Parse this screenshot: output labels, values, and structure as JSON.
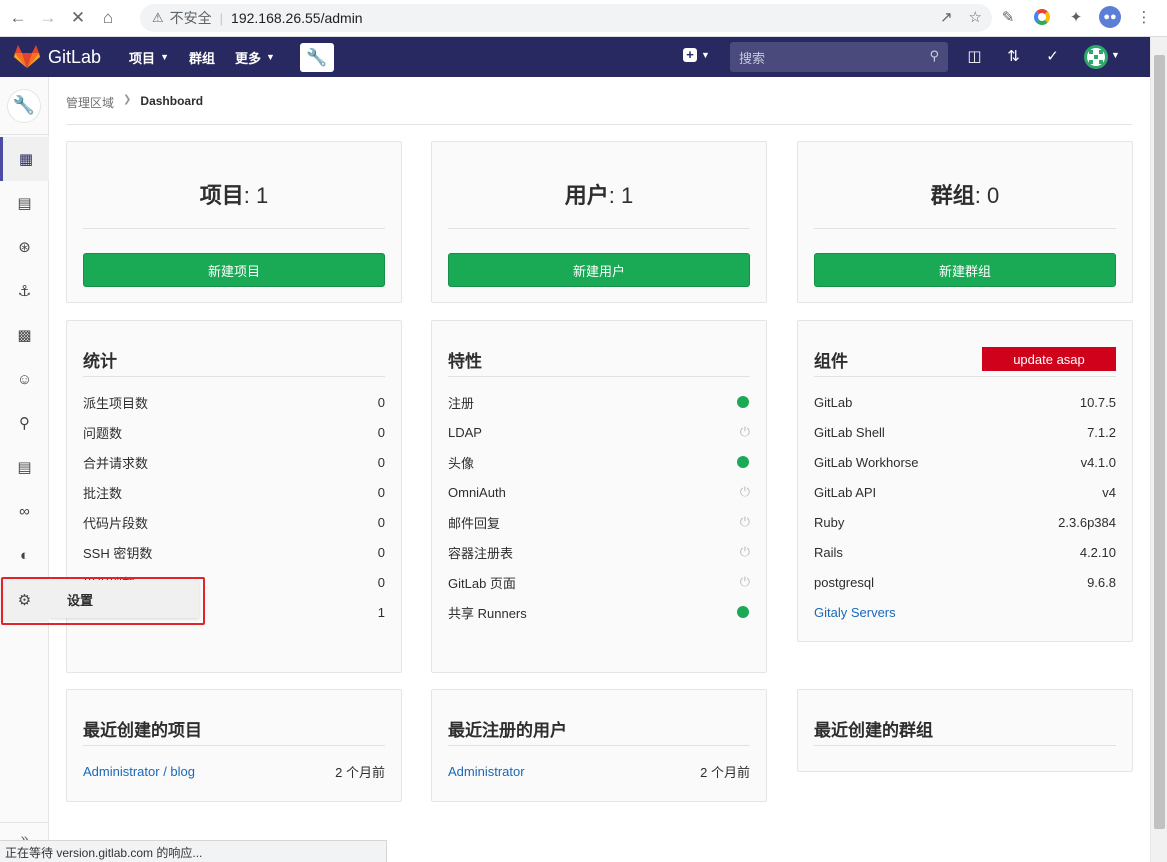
{
  "browser": {
    "insecure_label": "不安全",
    "url": "192.168.26.55/admin"
  },
  "navbar": {
    "brand": "GitLab",
    "menu": [
      "项目",
      "群组",
      "更多"
    ],
    "search_placeholder": "搜索"
  },
  "sidebar": {
    "flyout_label": "设置"
  },
  "breadcrumb": {
    "root": "管理区域",
    "current": "Dashboard"
  },
  "summary_cards": [
    {
      "label": "项目",
      "value": ": 1",
      "button": "新建项目"
    },
    {
      "label": "用户",
      "value": ": 1",
      "button": "新建用户"
    },
    {
      "label": "群组",
      "value": ": 0",
      "button": "新建群组"
    }
  ],
  "stats": {
    "title": "统计",
    "rows": [
      {
        "label": "派生项目数",
        "value": "0"
      },
      {
        "label": "问题数",
        "value": "0"
      },
      {
        "label": "合并请求数",
        "value": "0"
      },
      {
        "label": "批注数",
        "value": "0"
      },
      {
        "label": "代码片段数",
        "value": "0"
      },
      {
        "label": "SSH 密钥数",
        "value": "0"
      },
      {
        "label": "里程碑数",
        "value": "0"
      },
      {
        "label": "",
        "value": "1"
      }
    ]
  },
  "features": {
    "title": "特性",
    "rows": [
      {
        "label": "注册",
        "enabled": true
      },
      {
        "label": "LDAP",
        "enabled": false
      },
      {
        "label": "头像",
        "enabled": true
      },
      {
        "label": "OmniAuth",
        "enabled": false
      },
      {
        "label": "邮件回复",
        "enabled": false
      },
      {
        "label": "容器注册表",
        "enabled": false
      },
      {
        "label": "GitLab 页面",
        "enabled": false
      },
      {
        "label": "共享 Runners",
        "enabled": true
      }
    ]
  },
  "components": {
    "title": "组件",
    "badge": "update asap",
    "rows": [
      {
        "label": "GitLab",
        "value": "10.7.5"
      },
      {
        "label": "GitLab Shell",
        "value": "7.1.2"
      },
      {
        "label": "GitLab Workhorse",
        "value": "v4.1.0"
      },
      {
        "label": "GitLab API",
        "value": "v4"
      },
      {
        "label": "Ruby",
        "value": "2.3.6p384"
      },
      {
        "label": "Rails",
        "value": "4.2.10"
      },
      {
        "label": "postgresql",
        "value": "9.6.8"
      }
    ],
    "link": "Gitaly Servers"
  },
  "recent": [
    {
      "title": "最近创建的项目",
      "item": "Administrator / blog",
      "time": "2 个月前"
    },
    {
      "title": "最近注册的用户",
      "item": "Administrator",
      "time": "2 个月前"
    },
    {
      "title": "最近创建的群组",
      "item": "",
      "time": ""
    }
  ],
  "status_bar": "正在等待 version.gitlab.com 的响应..."
}
